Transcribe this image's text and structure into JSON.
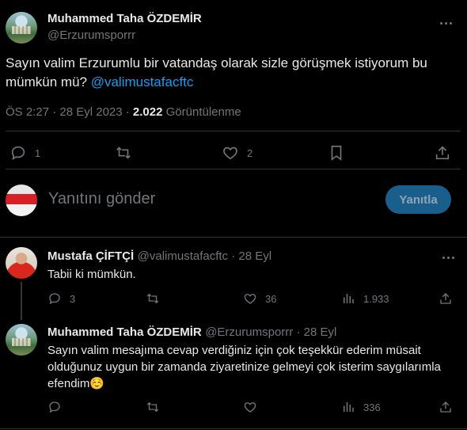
{
  "main_tweet": {
    "author_name": "Muhammed Taha ÖZDEMİR",
    "author_handle": "@Erzurumsporrr",
    "text": "Sayın valim Erzurumlu bir vatandaş olarak sizle görüşmek istiyorum bu mümkün mü? ",
    "mention": "@valimustafacftc",
    "timestamp": "ÖS 2:27 · 28 Eyl 2023 · ",
    "views_count": "2.022",
    "views_label": " Görüntülenme",
    "replies": "1",
    "retweets": "",
    "likes": "2"
  },
  "compose": {
    "placeholder": "Yanıtını gönder",
    "button_label": "Yanıtla"
  },
  "replies": [
    {
      "author_name": "Mustafa ÇİFTÇİ",
      "author_handle": "@valimustafacftc · 28 Eyl",
      "text": "Tabii ki mümkün.",
      "replies": "3",
      "retweets": "",
      "likes": "36",
      "views": "1.933"
    },
    {
      "author_name": "Muhammed Taha ÖZDEMİR",
      "author_handle": "@Erzurumsporrr · 28 Eyl",
      "text": "Sayın valim  mesajıma cevap verdiğiniz için  çok teşekkür ederim müsait olduğunuz uygun bir zamanda ziyaretinize gelmeyi çok isterim saygılarımla efendim☺️",
      "replies": "",
      "retweets": "",
      "likes": "",
      "views": "336"
    }
  ],
  "colors": {
    "background": "#000000",
    "text": "#e7e9ea",
    "muted": "#71767b",
    "link": "#1d9bf0",
    "divider": "#2f3336",
    "button": "#1a5e8c"
  },
  "icons": [
    "more-icon",
    "reply-icon",
    "retweet-icon",
    "like-icon",
    "bookmark-icon",
    "share-icon",
    "views-icon"
  ]
}
